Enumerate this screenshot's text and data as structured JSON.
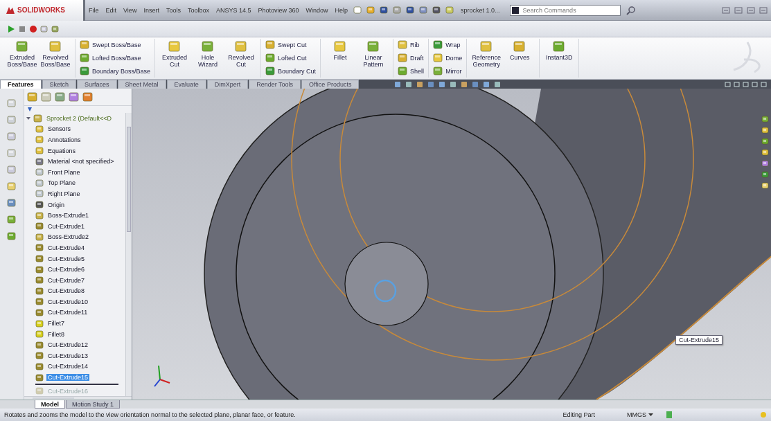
{
  "app": {
    "logo": "SOLIDWORKS"
  },
  "menu": [
    {
      "label": "File"
    },
    {
      "label": "Edit"
    },
    {
      "label": "View"
    },
    {
      "label": "Insert"
    },
    {
      "label": "Tools"
    },
    {
      "label": "Toolbox"
    },
    {
      "label": "ANSYS 14.5"
    },
    {
      "label": "Photoview 360"
    },
    {
      "label": "Window"
    },
    {
      "label": "Help"
    }
  ],
  "document_title": "sprocket 1.0...",
  "search": {
    "placeholder": "Search Commands"
  },
  "ribbon": {
    "groups": [
      {
        "kind": "large",
        "items": [
          {
            "label": "Extruded Boss/Base"
          },
          {
            "label": "Revolved Boss/Base"
          }
        ]
      },
      {
        "kind": "stack",
        "items": [
          {
            "label": "Swept Boss/Base"
          },
          {
            "label": "Lofted Boss/Base"
          },
          {
            "label": "Boundary Boss/Base"
          }
        ]
      },
      {
        "kind": "large",
        "items": [
          {
            "label": "Extruded Cut"
          },
          {
            "label": "Hole Wizard"
          },
          {
            "label": "Revolved Cut"
          }
        ]
      },
      {
        "kind": "stack",
        "items": [
          {
            "label": "Swept Cut"
          },
          {
            "label": "Lofted Cut"
          },
          {
            "label": "Boundary Cut"
          }
        ]
      },
      {
        "kind": "large",
        "items": [
          {
            "label": "Fillet"
          },
          {
            "label": "Linear Pattern"
          }
        ]
      },
      {
        "kind": "stack",
        "items": [
          {
            "label": "Rib"
          },
          {
            "label": "Draft"
          },
          {
            "label": "Shell"
          }
        ]
      },
      {
        "kind": "stack",
        "items": [
          {
            "label": "Wrap"
          },
          {
            "label": "Dome"
          },
          {
            "label": "Mirror"
          }
        ]
      },
      {
        "kind": "large",
        "items": [
          {
            "label": "Reference Geometry"
          },
          {
            "label": "Curves"
          }
        ]
      },
      {
        "kind": "large",
        "items": [
          {
            "label": "Instant3D"
          }
        ]
      }
    ]
  },
  "tabs": [
    {
      "label": "Features",
      "selected": true
    },
    {
      "label": "Sketch",
      "selected": false
    },
    {
      "label": "Surfaces",
      "selected": false
    },
    {
      "label": "Sheet Metal",
      "selected": false
    },
    {
      "label": "Evaluate",
      "selected": false
    },
    {
      "label": "DimXpert",
      "selected": false
    },
    {
      "label": "Render Tools",
      "selected": false
    },
    {
      "label": "Office Products",
      "selected": false
    }
  ],
  "feature_tree": {
    "root": {
      "label": "Sprocket 2 (Default<<D",
      "expanded": true,
      "children": [
        {
          "label": "Sensors",
          "kind": "folder",
          "selected": false,
          "disabled": false
        },
        {
          "label": "Annotations",
          "kind": "folder",
          "selected": false,
          "disabled": false
        },
        {
          "label": "Equations",
          "kind": "folder",
          "selected": false,
          "disabled": false
        },
        {
          "label": "Material <not specified>",
          "kind": "material",
          "selected": false,
          "disabled": false
        },
        {
          "label": "Front Plane",
          "kind": "plane",
          "selected": false,
          "disabled": false
        },
        {
          "label": "Top Plane",
          "kind": "plane",
          "selected": false,
          "disabled": false
        },
        {
          "label": "Right Plane",
          "kind": "plane",
          "selected": false,
          "disabled": false
        },
        {
          "label": "Origin",
          "kind": "origin",
          "selected": false,
          "disabled": false
        },
        {
          "label": "Boss-Extrude1",
          "kind": "boss",
          "selected": false,
          "disabled": false
        },
        {
          "label": "Cut-Extrude1",
          "kind": "cut",
          "selected": false,
          "disabled": false
        },
        {
          "label": "Boss-Extrude2",
          "kind": "boss",
          "selected": false,
          "disabled": false
        },
        {
          "label": "Cut-Extrude4",
          "kind": "cut",
          "selected": false,
          "disabled": false
        },
        {
          "label": "Cut-Extrude5",
          "kind": "cut",
          "selected": false,
          "disabled": false
        },
        {
          "label": "Cut-Extrude6",
          "kind": "cut",
          "selected": false,
          "disabled": false
        },
        {
          "label": "Cut-Extrude7",
          "kind": "cut",
          "selected": false,
          "disabled": false
        },
        {
          "label": "Cut-Extrude8",
          "kind": "cut",
          "selected": false,
          "disabled": false
        },
        {
          "label": "Cut-Extrude10",
          "kind": "cut",
          "selected": false,
          "disabled": false
        },
        {
          "label": "Cut-Extrude11",
          "kind": "cut",
          "selected": false,
          "disabled": false
        },
        {
          "label": "Fillet7",
          "kind": "fillet",
          "selected": false,
          "disabled": false
        },
        {
          "label": "Fillet8",
          "kind": "fillet",
          "selected": false,
          "disabled": false
        },
        {
          "label": "Cut-Extrude12",
          "kind": "cut",
          "selected": false,
          "disabled": false
        },
        {
          "label": "Cut-Extrude13",
          "kind": "cut",
          "selected": false,
          "disabled": false
        },
        {
          "label": "Cut-Extrude14",
          "kind": "cut",
          "selected": false,
          "disabled": false
        },
        {
          "label": "Cut-Extrude15",
          "kind": "cut",
          "selected": true,
          "disabled": false
        },
        {
          "label": "Cut-Extrude16",
          "kind": "cut",
          "selected": false,
          "disabled": true
        }
      ]
    }
  },
  "viewport": {
    "tooltip": "Cut-Extrude15"
  },
  "bottom_tabs": [
    {
      "label": "Model",
      "selected": true
    },
    {
      "label": "Motion Study 1",
      "selected": false
    }
  ],
  "status_bar": {
    "message": "Rotates and zooms the model to the view orientation normal to the selected plane, planar face, or feature.",
    "mode": "Editing Part",
    "units": "MMGS"
  }
}
